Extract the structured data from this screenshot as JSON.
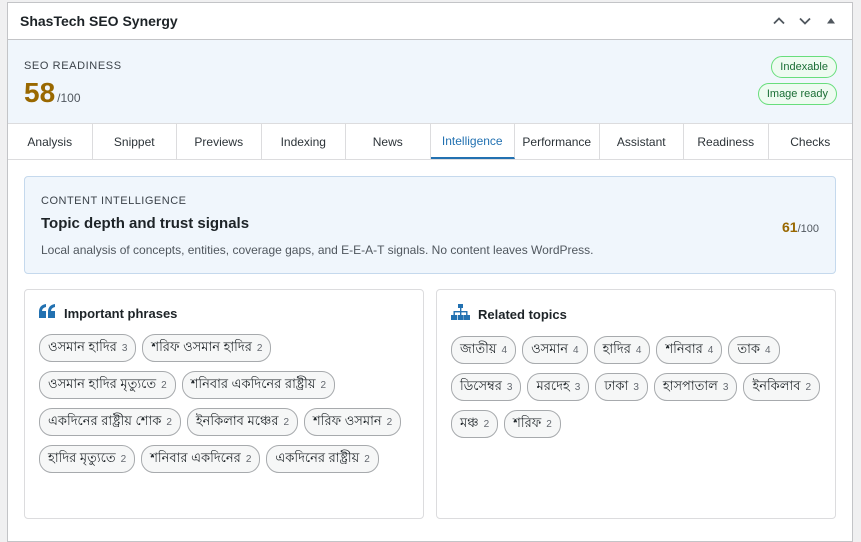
{
  "panel": {
    "title": "ShasTech SEO Synergy"
  },
  "readiness": {
    "label": "SEO READINESS",
    "score": "58",
    "max": "/100",
    "badges": [
      "Indexable",
      "Image ready"
    ]
  },
  "tabs": [
    {
      "label": "Analysis"
    },
    {
      "label": "Snippet"
    },
    {
      "label": "Previews"
    },
    {
      "label": "Indexing"
    },
    {
      "label": "News"
    },
    {
      "label": "Intelligence"
    },
    {
      "label": "Performance"
    },
    {
      "label": "Assistant"
    },
    {
      "label": "Readiness"
    },
    {
      "label": "Checks"
    }
  ],
  "intel": {
    "kicker": "CONTENT INTELLIGENCE",
    "title": "Topic depth and trust signals",
    "description": "Local analysis of concepts, entities, coverage gaps, and E-E-A-T signals. No content leaves WordPress.",
    "score": "61",
    "max": "/100"
  },
  "phrases": {
    "title": "Important phrases",
    "items": [
      {
        "text": "ওসমান হাদির",
        "count": "3"
      },
      {
        "text": "শরিফ ওসমান হাদির",
        "count": "2"
      },
      {
        "text": "ওসমান হাদির মৃত্যুতে",
        "count": "2"
      },
      {
        "text": "শনিবার একদিনের রাষ্ট্রীয়",
        "count": "2"
      },
      {
        "text": "একদিনের রাষ্ট্রীয় শোক",
        "count": "2"
      },
      {
        "text": "ইনকিলাব মঞ্চের",
        "count": "2"
      },
      {
        "text": "শরিফ ওসমান",
        "count": "2"
      },
      {
        "text": "হাদির মৃত্যুতে",
        "count": "2"
      },
      {
        "text": "শনিবার একদিনের",
        "count": "2"
      },
      {
        "text": "একদিনের রাষ্ট্রীয়",
        "count": "2"
      }
    ]
  },
  "topics": {
    "title": "Related topics",
    "items": [
      {
        "text": "জাতীয়",
        "count": "4"
      },
      {
        "text": "ওসমান",
        "count": "4"
      },
      {
        "text": "হাদির",
        "count": "4"
      },
      {
        "text": "শনিবার",
        "count": "4"
      },
      {
        "text": "তাক",
        "count": "4"
      },
      {
        "text": "ডিসেম্বর",
        "count": "3"
      },
      {
        "text": "মরদেহ",
        "count": "3"
      },
      {
        "text": "ঢাকা",
        "count": "3"
      },
      {
        "text": "হাসপাতাল",
        "count": "3"
      },
      {
        "text": "ইনকিলাব",
        "count": "2"
      },
      {
        "text": "মঞ্চ",
        "count": "2"
      },
      {
        "text": "শরিফ",
        "count": "2"
      }
    ]
  },
  "icons": {
    "collapse_up": "chevron-up-icon",
    "move_down": "chevron-down-icon",
    "toggle": "triangle-up-icon",
    "phrases": "quote-icon",
    "topics": "sitemap-icon"
  },
  "colors": {
    "accent": "#2271b1",
    "score": "#996800",
    "badge_green": "#1a6e35"
  }
}
